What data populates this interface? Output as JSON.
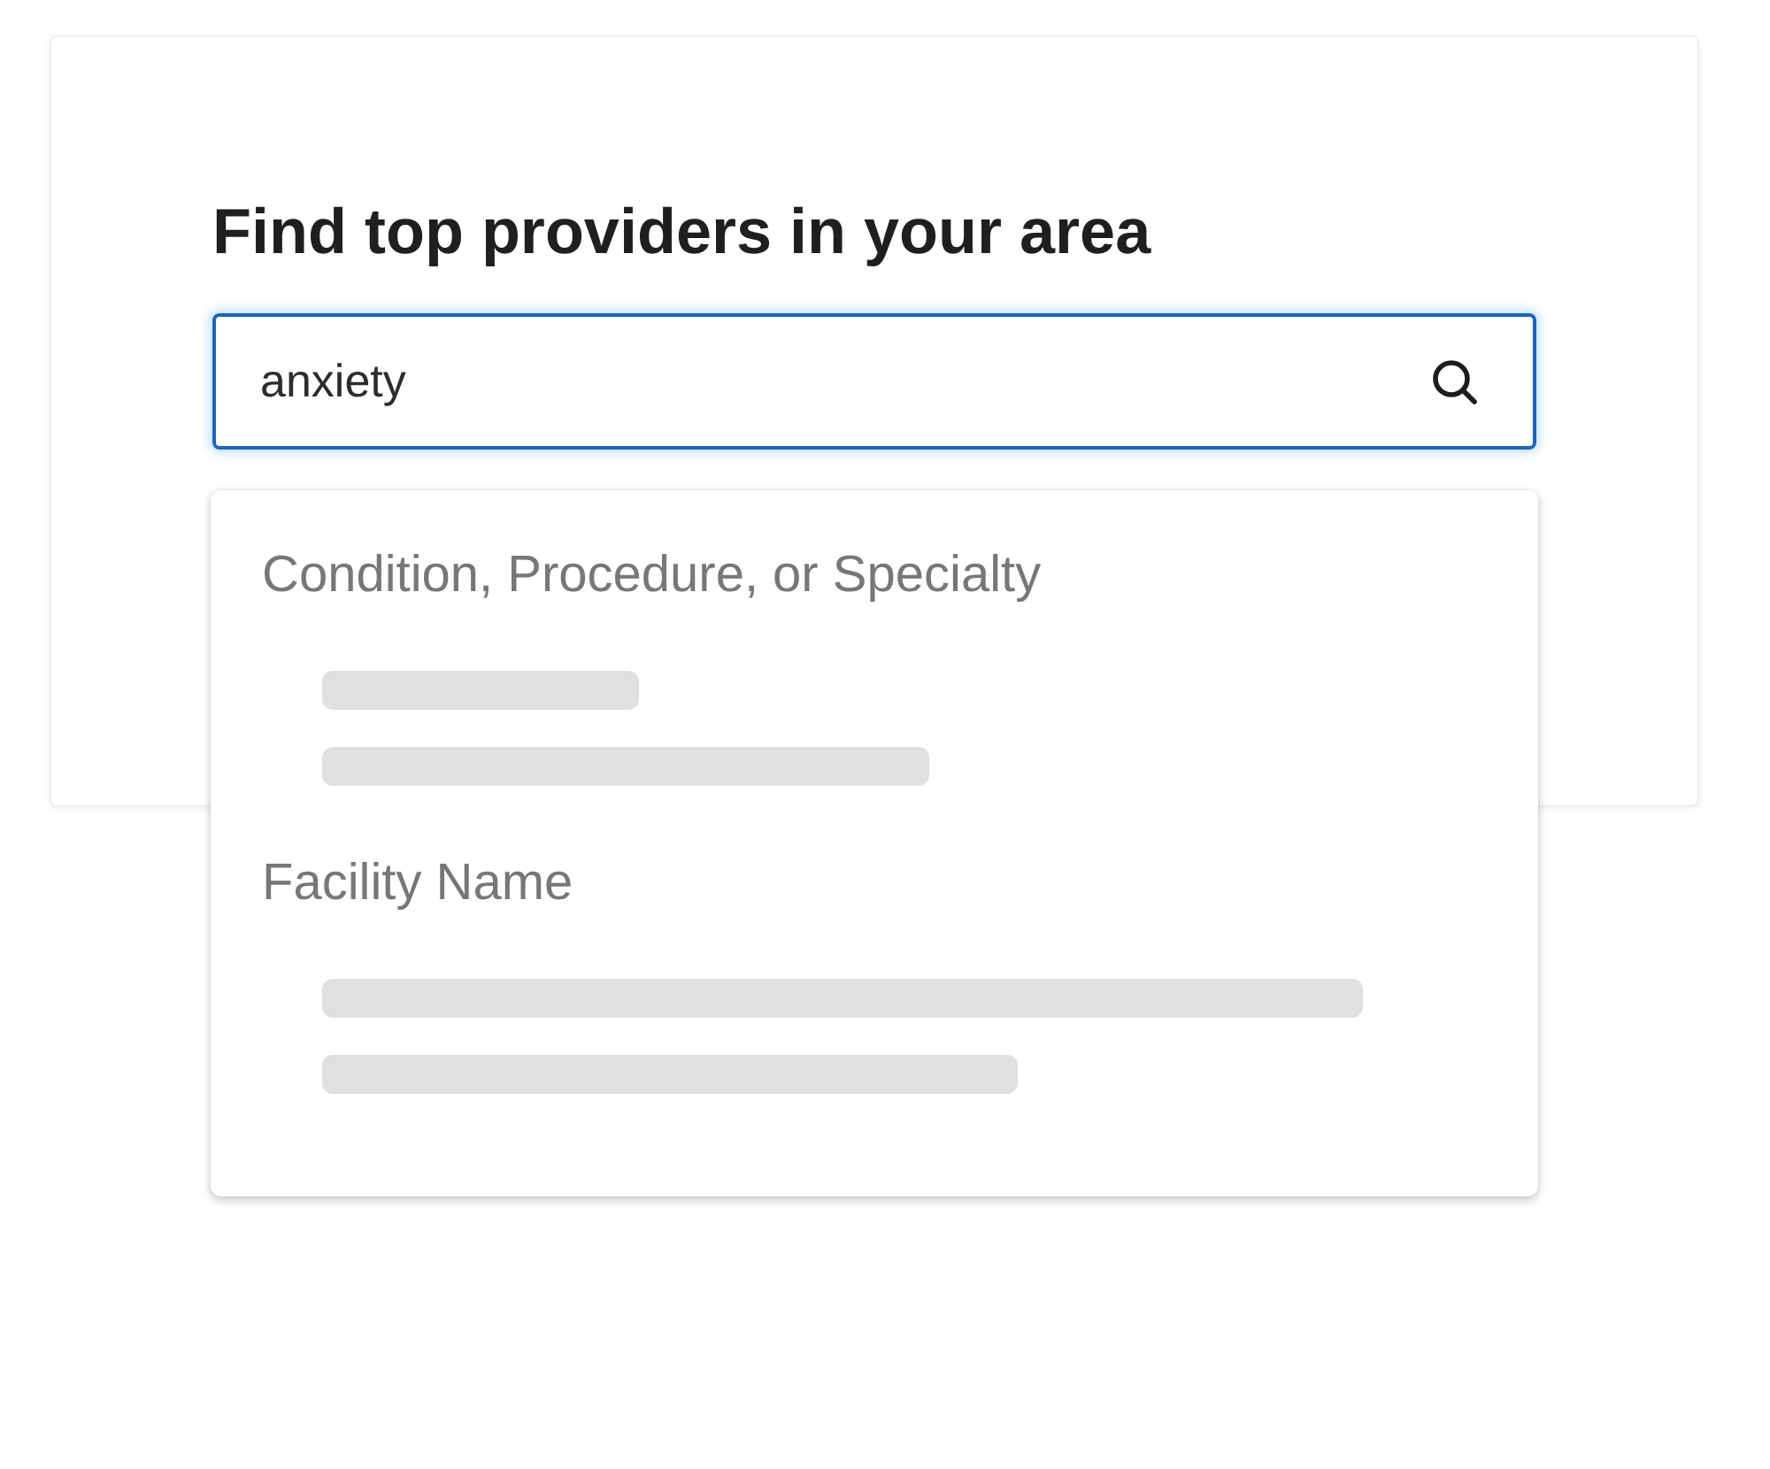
{
  "card": {
    "title": "Find top providers in your area"
  },
  "search": {
    "value": "anxiety",
    "focused": true
  },
  "suggestions": {
    "sections": [
      {
        "heading": "Condition, Procedure, or Specialty",
        "loading": true
      },
      {
        "heading": "Facility Name",
        "loading": true
      }
    ]
  }
}
